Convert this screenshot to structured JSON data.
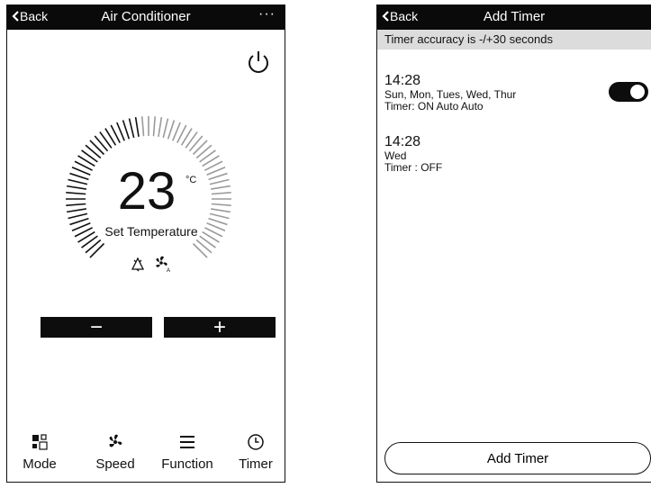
{
  "ac_screen": {
    "back_label": "Back",
    "title": "Air Conditioner",
    "more_label": "···",
    "temperature": "23",
    "unit": "°C",
    "set_temperature_label": "Set Temperature",
    "minus_label": "−",
    "plus_label": "+",
    "icons": {
      "power": "power-icon",
      "mode_status": "recycle-icon",
      "fan_status": "auto-fan-icon"
    },
    "nav": [
      {
        "label": "Mode",
        "icon": "mode-icon"
      },
      {
        "label": "Speed",
        "icon": "fan-icon"
      },
      {
        "label": "Function",
        "icon": "menu-icon"
      },
      {
        "label": "Timer",
        "icon": "clock-icon"
      }
    ]
  },
  "timer_screen": {
    "back_label": "Back",
    "title": "Add Timer",
    "banner": "Timer accuracy is -/+30 seconds",
    "timers": [
      {
        "time": "14:28",
        "days": "Sun, Mon, Tues, Wed, Thur",
        "detail": "Timer: ON Auto Auto",
        "enabled": true
      },
      {
        "time": "14:28",
        "days": "Wed",
        "detail": "Timer : OFF"
      }
    ],
    "add_button_label": "Add Timer"
  },
  "colors": {
    "bar": "#0a0a0a",
    "banner": "#dcdcdc",
    "text": "#111111",
    "background": "#ffffff"
  }
}
